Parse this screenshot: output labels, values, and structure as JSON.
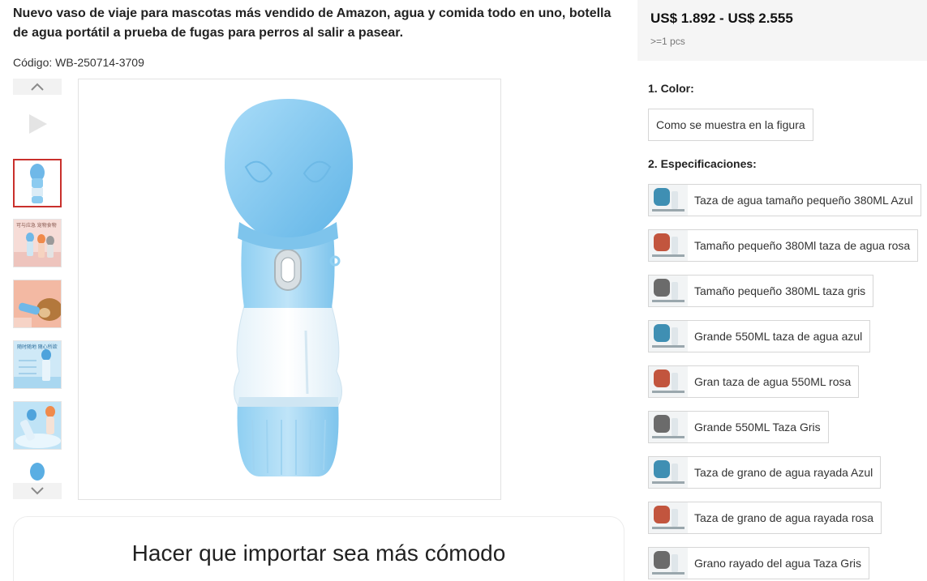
{
  "product": {
    "title": "Nuevo vaso de viaje para mascotas más vendido de Amazon, agua y comida todo en uno, botella de agua portátil a prueba de fugas para perros al salir a pasear.",
    "code": "Código: WB-250714-3709"
  },
  "gallery": {
    "thumb_texts": [
      "可与应急 宠物食物",
      "随时随地 随心所欲"
    ]
  },
  "banner": {
    "title": "Hacer que importar sea más cómodo"
  },
  "pricing": {
    "range": "US$ 1.892 - US$ 2.555",
    "moq": ">=1 pcs"
  },
  "options": {
    "color_label": "1. Color:",
    "color_value": "Como se muestra en la figura",
    "spec_label": "2. Especificaciones:",
    "specs": [
      {
        "label": "Taza de agua tamaño pequeño 380ML Azul",
        "color": "#3f8fb3"
      },
      {
        "label": "Tamaño pequeño 380Ml taza de agua rosa",
        "color": "#c2553e"
      },
      {
        "label": "Tamaño pequeño 380ML taza gris",
        "color": "#6b6b6b"
      },
      {
        "label": "Grande 550ML taza de agua azul",
        "color": "#3f8fb3"
      },
      {
        "label": "Gran taza de agua 550ML rosa",
        "color": "#c2553e"
      },
      {
        "label": "Grande 550ML Taza Gris",
        "color": "#6b6b6b"
      },
      {
        "label": "Taza de grano de agua rayada Azul",
        "color": "#3f8fb3"
      },
      {
        "label": "Taza de grano de agua rayada rosa",
        "color": "#c2553e"
      },
      {
        "label": "Grano rayado del agua Taza Gris",
        "color": "#6b6b6b"
      }
    ]
  },
  "colors": {
    "accent_red": "#c9302c",
    "bottle_blue": "#7cc3ee"
  }
}
